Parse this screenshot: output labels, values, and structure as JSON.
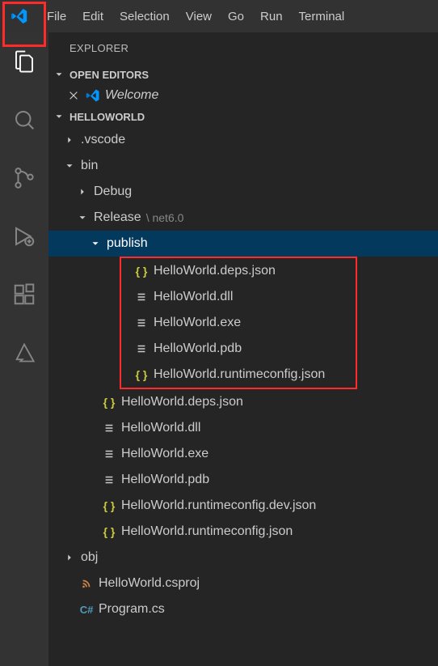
{
  "menubar": {
    "items": [
      "File",
      "Edit",
      "Selection",
      "View",
      "Go",
      "Run",
      "Terminal"
    ]
  },
  "sidebar": {
    "title": "EXPLORER",
    "openEditors": {
      "label": "OPEN EDITORS",
      "items": [
        {
          "label": "Welcome"
        }
      ]
    },
    "workspace": {
      "label": "HELLOWORLD"
    }
  },
  "tree": {
    "vscode": ".vscode",
    "bin": "bin",
    "debug": "Debug",
    "release": "Release",
    "releasePath": "\\ net6.0",
    "publish": "publish",
    "publishFiles": [
      "HelloWorld.deps.json",
      "HelloWorld.dll",
      "HelloWorld.exe",
      "HelloWorld.pdb",
      "HelloWorld.runtimeconfig.json"
    ],
    "releaseFiles": [
      "HelloWorld.deps.json",
      "HelloWorld.dll",
      "HelloWorld.exe",
      "HelloWorld.pdb",
      "HelloWorld.runtimeconfig.dev.json",
      "HelloWorld.runtimeconfig.json"
    ],
    "obj": "obj",
    "csproj": "HelloWorld.csproj",
    "programcs": "Program.cs"
  }
}
